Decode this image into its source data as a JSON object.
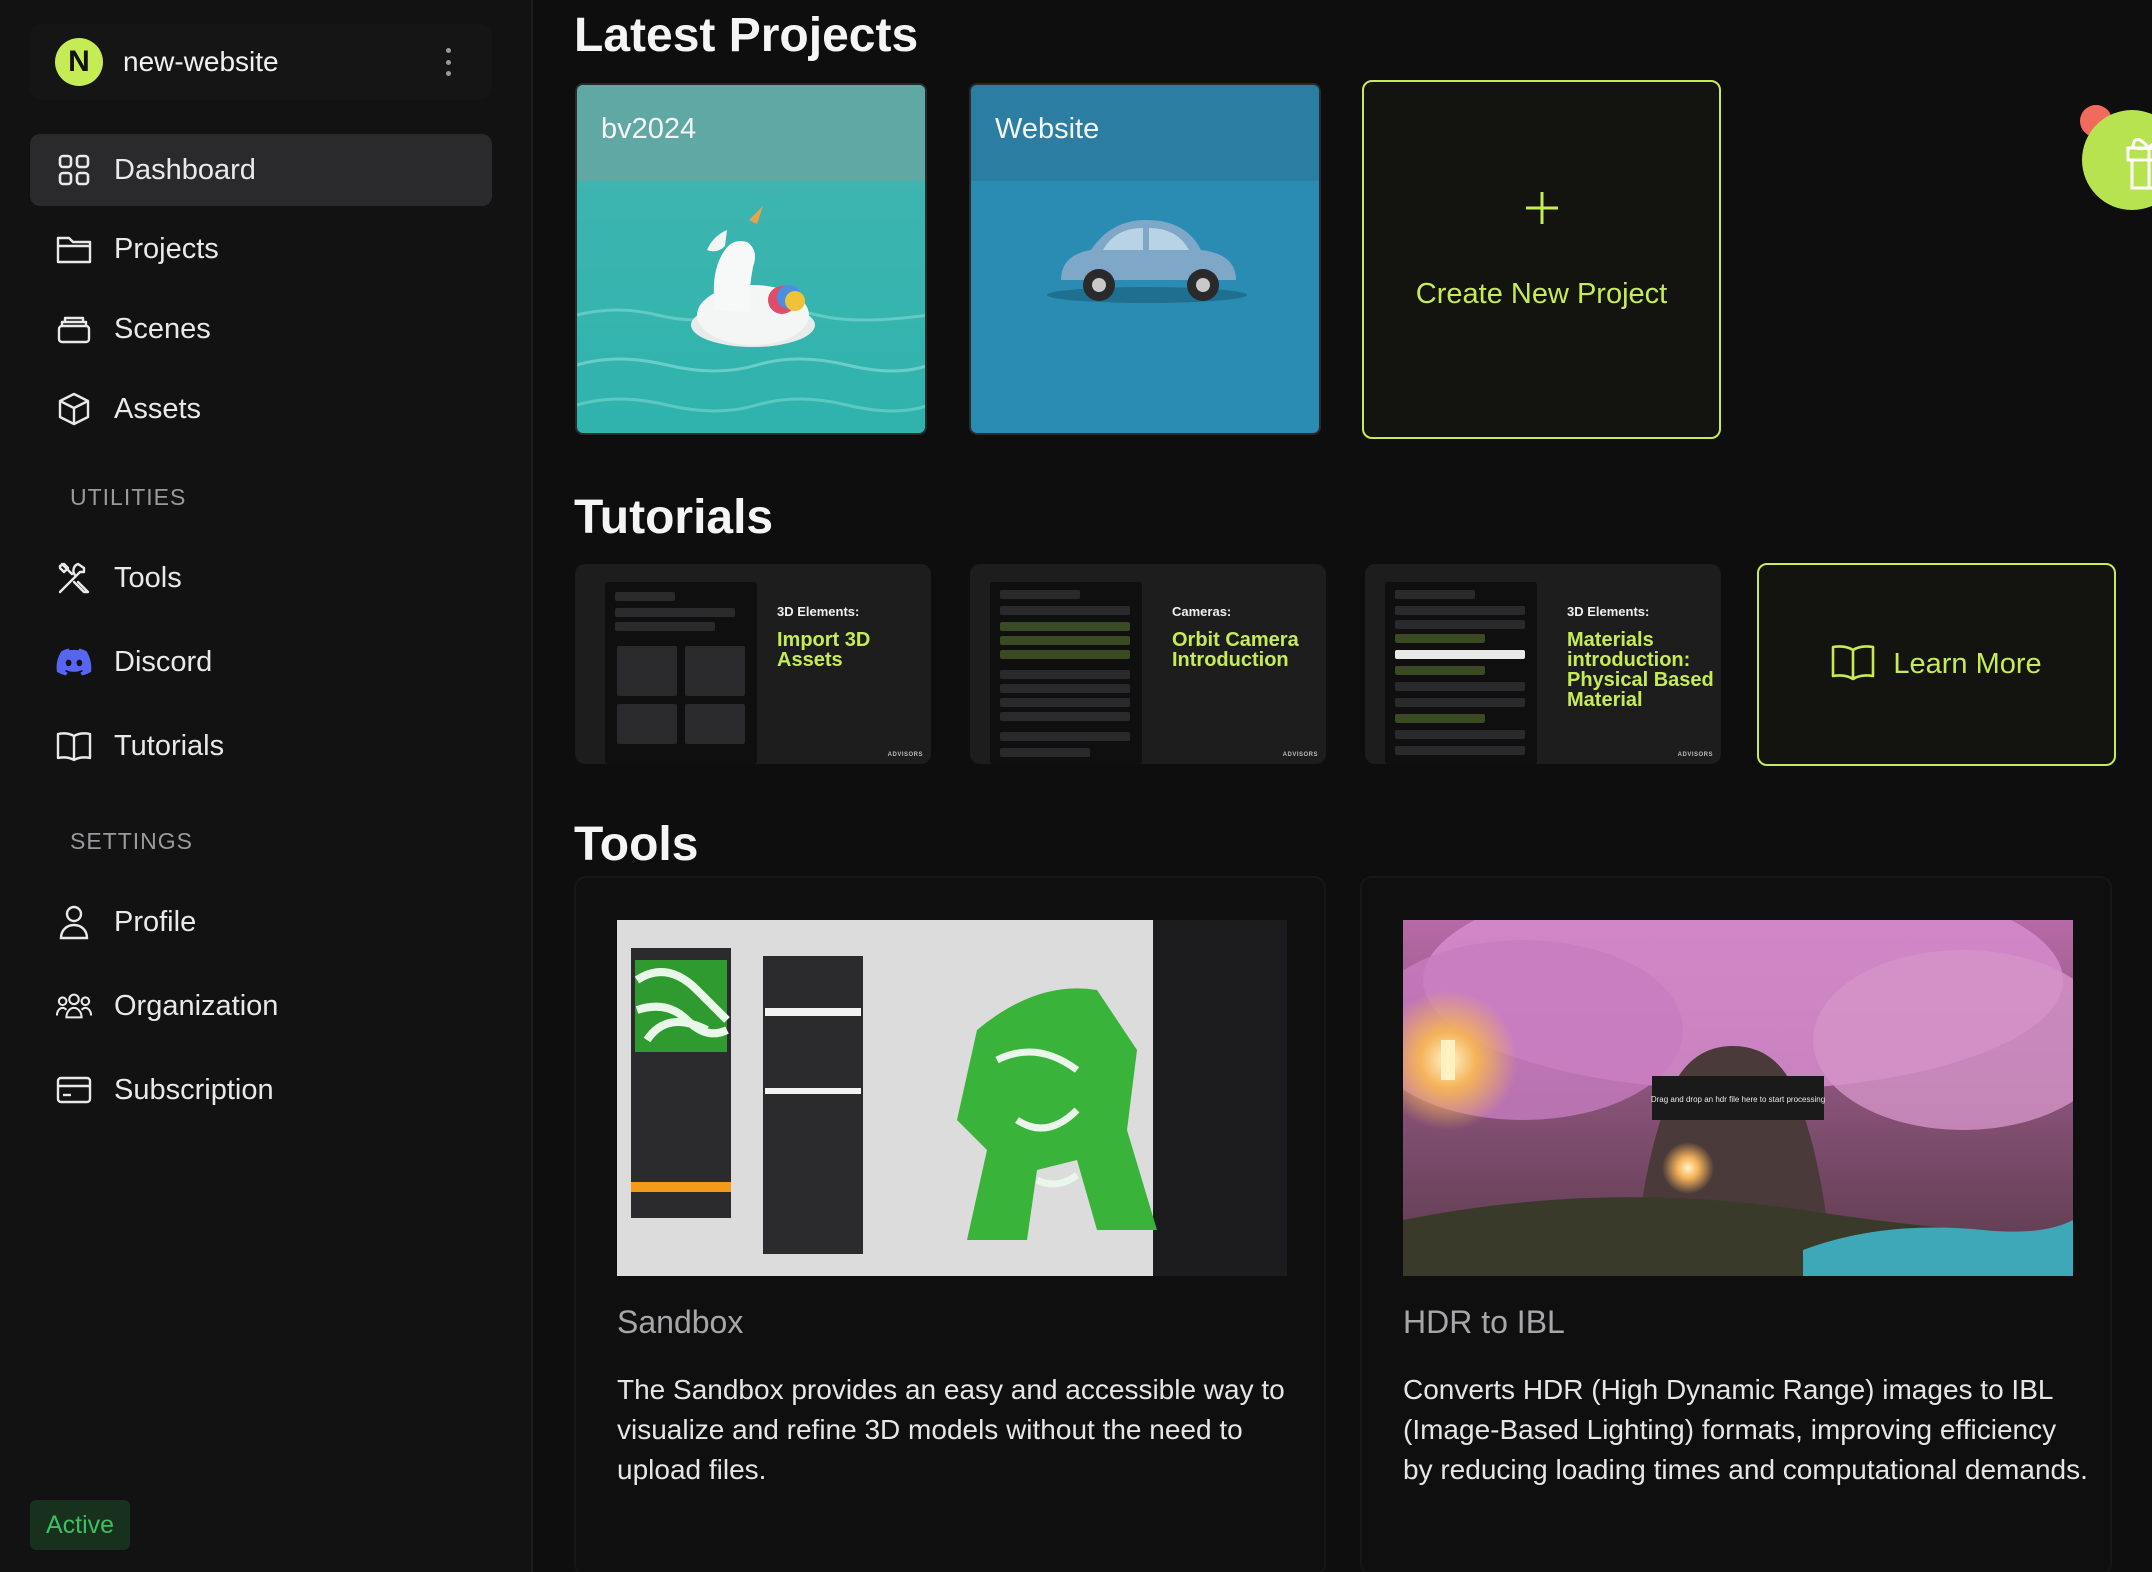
{
  "workspace": {
    "initial": "N",
    "name": "new-website"
  },
  "nav": {
    "main": [
      {
        "label": "Dashboard",
        "icon": "grid-icon",
        "active": true
      },
      {
        "label": "Projects",
        "icon": "folder-icon"
      },
      {
        "label": "Scenes",
        "icon": "layers-icon"
      },
      {
        "label": "Assets",
        "icon": "cube-icon"
      }
    ],
    "utilities_label": "UTILITIES",
    "utilities": [
      {
        "label": "Tools",
        "icon": "tools-icon"
      },
      {
        "label": "Discord",
        "icon": "discord-icon"
      },
      {
        "label": "Tutorials",
        "icon": "book-icon"
      }
    ],
    "settings_label": "SETTINGS",
    "settings": [
      {
        "label": "Profile",
        "icon": "user-icon"
      },
      {
        "label": "Organization",
        "icon": "team-icon"
      },
      {
        "label": "Subscription",
        "icon": "credit-card-icon"
      }
    ]
  },
  "status": "Active",
  "latest_projects": {
    "heading": "Latest Projects",
    "items": [
      {
        "name": "bv2024"
      },
      {
        "name": "Website"
      }
    ],
    "create_label": "Create New Project"
  },
  "tutorials": {
    "heading": "Tutorials",
    "items": [
      {
        "category": "3D Elements:",
        "title": "Import 3D Assets",
        "brand": "ADVISORS"
      },
      {
        "category": "Cameras:",
        "title": "Orbit Camera Introduction",
        "brand": "ADVISORS"
      },
      {
        "category": "3D Elements:",
        "title": "Materials introduction: Physical Based Material",
        "brand": "ADVISORS"
      }
    ],
    "learn_more": "Learn More"
  },
  "tools": {
    "heading": "Tools",
    "items": [
      {
        "name": "Sandbox",
        "description": "The Sandbox provides an easy and accessible way to visualize and refine 3D models without the need to upload files."
      },
      {
        "name": "HDR to IBL",
        "description": "Converts HDR (High Dynamic Range) images to IBL (Image-Based Lighting) formats, improving efficiency by reducing loading times and computational demands.",
        "overlay_text": "Drag and drop an hdr file here to start processing"
      }
    ]
  },
  "colors": {
    "accent": "#c5ec55",
    "background": "#0e0e0f",
    "sidebar": "#121213",
    "active_bg": "#2a2a2c",
    "status_green": "#3fbf5f"
  }
}
